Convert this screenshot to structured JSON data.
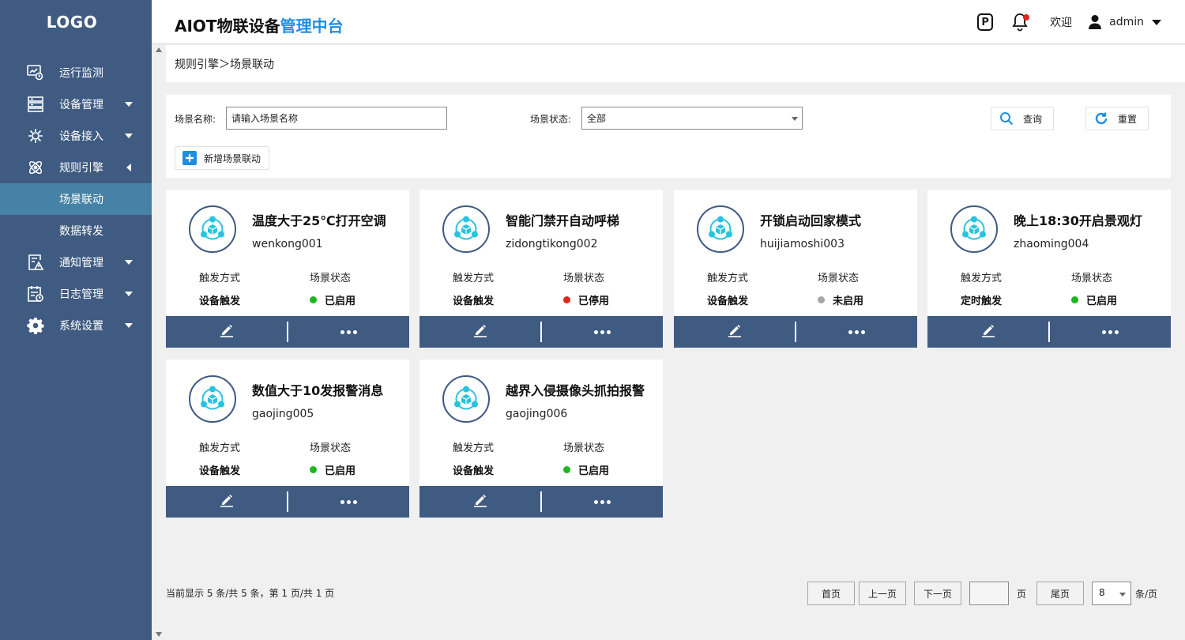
{
  "logo": "LOGO",
  "app": {
    "title_main": "AIOT物联设备",
    "title_highlight": "管理中台",
    "accent": "#1d8fe3"
  },
  "header": {
    "parking_label": "P",
    "welcome": "欢迎",
    "username": "admin"
  },
  "sidebar": {
    "items": [
      {
        "label": "运行监测"
      },
      {
        "label": "设备管理"
      },
      {
        "label": "设备接入"
      },
      {
        "label": "规则引擎"
      },
      {
        "label": "场景联动"
      },
      {
        "label": "数据转发"
      },
      {
        "label": "通知管理"
      },
      {
        "label": "日志管理"
      },
      {
        "label": "系统设置"
      }
    ]
  },
  "breadcrumb": "规则引擎＞场景联动",
  "filter": {
    "name_label": "场景名称:",
    "name_placeholder": "请输入场景名称",
    "status_label": "场景状态:",
    "status_value": "全部",
    "query_label": "查询",
    "reset_label": "重置",
    "add_label": "新增场景联动"
  },
  "card_labels": {
    "trigger": "触发方式",
    "status": "场景状态"
  },
  "cards": [
    {
      "title": "温度大于25℃打开空调",
      "code": "wenkong001",
      "trigger": "设备触发",
      "status": "已启用",
      "status_color": "#1fb51f"
    },
    {
      "title": "智能门禁开自动呼梯",
      "code": "zidongtikong002",
      "trigger": "设备触发",
      "status": "已停用",
      "status_color": "#d8281e"
    },
    {
      "title": "开锁启动回家模式",
      "code": "huijiamoshi003",
      "trigger": "设备触发",
      "status": "未启用",
      "status_color": "#a7a7a7"
    },
    {
      "title": "晚上18:30开启景观灯",
      "code": "zhaoming004",
      "trigger": "定时触发",
      "status": "已启用",
      "status_color": "#1fb51f"
    },
    {
      "title": "数值大于10发报警消息",
      "code": "gaojing005",
      "trigger": "设备触发",
      "status": "已启用",
      "status_color": "#1fb51f"
    },
    {
      "title": "越界入侵摄像头抓拍报警",
      "code": "gaojing006",
      "trigger": "设备触发",
      "status": "已启用",
      "status_color": "#1fb51f"
    }
  ],
  "pagination": {
    "info": "当前显示 5 条/共 5 条，第 1 页/共 1 页",
    "first": "首页",
    "prev": "上一页",
    "next": "下一页",
    "page_unit": "页",
    "last": "尾页",
    "page_size": "8",
    "size_unit": "条/页"
  },
  "colors": {
    "sidebar_bg": "#3f5b82",
    "sidebar_active": "#4682a6",
    "icon_teal": "#29c3e0"
  }
}
